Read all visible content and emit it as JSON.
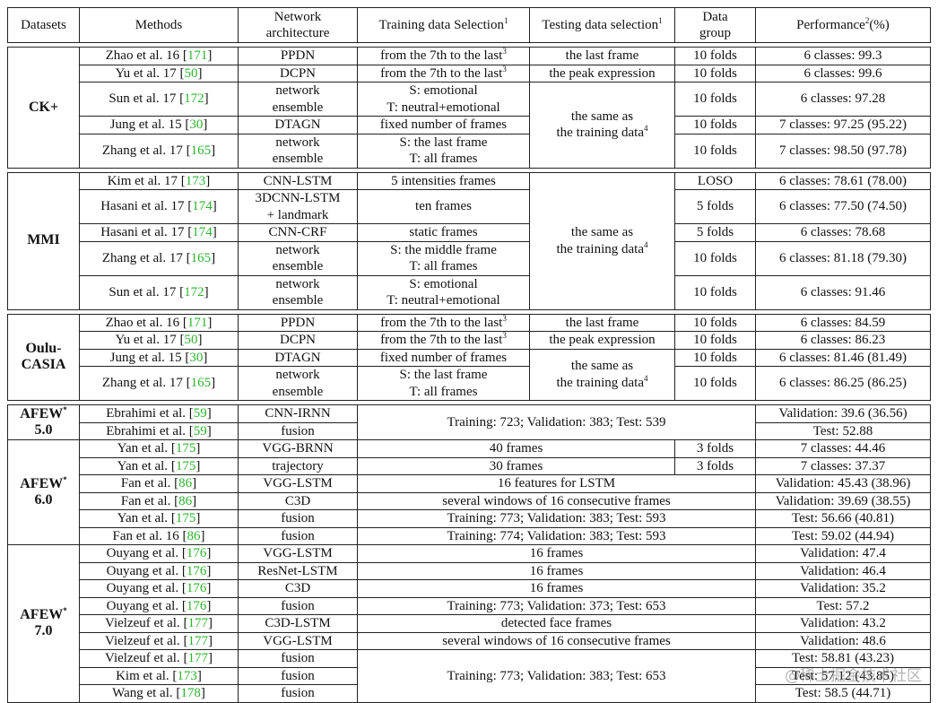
{
  "header": [
    {
      "t": "Datasets"
    },
    {
      "t": "Methods"
    },
    {
      "t": "Network\narchitecture"
    },
    {
      "t": "Training data Selection",
      "sup": "1"
    },
    {
      "t": "Testing data selection",
      "sup": "1"
    },
    {
      "t": "Data\ngroup"
    },
    {
      "t": "Performance",
      "sup": "2",
      "after": "(%)"
    }
  ],
  "accent_ref_color": "#2db32d",
  "watermark": "@稀土掘金技术社区",
  "blocks": [
    {
      "rows": [
        [
          {
            "t": "CK+",
            "ds": true,
            "rs": 5
          },
          {
            "m": "Zhao et al. 16",
            "ref": "171"
          },
          {
            "t": "PPDN"
          },
          {
            "t": "from the 7th to the last",
            "sup": "3"
          },
          {
            "t": "the last frame"
          },
          {
            "t": "10 folds"
          },
          {
            "t": "6 classes: 99.3"
          }
        ],
        [
          {
            "m": "Yu et al. 17",
            "ref": "50"
          },
          {
            "t": "DCPN"
          },
          {
            "t": "from the 7th to the last",
            "sup": "3"
          },
          {
            "t": "the peak expression"
          },
          {
            "t": "10 folds"
          },
          {
            "t": "6 classes: 99.6"
          }
        ],
        [
          {
            "m": "Sun et al. 17",
            "ref": "172"
          },
          {
            "t": "network\nensemble"
          },
          {
            "t": "S: emotional\nT: neutral+emotional"
          },
          {
            "t": "the same as\nthe training data",
            "sup": "4",
            "rs": 3
          },
          {
            "t": "10 folds"
          },
          {
            "t": "6 classes: 97.28"
          }
        ],
        [
          {
            "m": "Jung et al. 15",
            "ref": "30"
          },
          {
            "t": "DTAGN"
          },
          {
            "t": "fixed number of frames"
          },
          {
            "t": "10 folds"
          },
          {
            "t": "7 classes: 97.25 (95.22)"
          }
        ],
        [
          {
            "m": "Zhang et al. 17",
            "ref": "165"
          },
          {
            "t": "network\nensemble"
          },
          {
            "t": "S: the last frame\nT: all frames"
          },
          {
            "t": "10 folds"
          },
          {
            "t": "7 classes: 98.50 (97.78)"
          }
        ]
      ]
    },
    {
      "rows": [
        [
          {
            "t": "MMI",
            "ds": true,
            "rs": 5
          },
          {
            "m": "Kim et al. 17",
            "ref": "173"
          },
          {
            "t": "CNN-LSTM"
          },
          {
            "t": "5 intensities frames"
          },
          {
            "t": "the same as\nthe training data",
            "sup": "4",
            "rs": 5
          },
          {
            "t": "LOSO"
          },
          {
            "t": "6 classes: 78.61 (78.00)"
          }
        ],
        [
          {
            "m": "Hasani et al. 17",
            "ref": "174"
          },
          {
            "t": "3DCNN-LSTM\n+ landmark"
          },
          {
            "t": "ten frames"
          },
          {
            "t": "5 folds"
          },
          {
            "t": "6 classes: 77.50 (74.50)"
          }
        ],
        [
          {
            "m": "Hasani et al. 17",
            "ref": "174"
          },
          {
            "t": "CNN-CRF"
          },
          {
            "t": "static frames"
          },
          {
            "t": "5 folds"
          },
          {
            "t": "6 classes: 78.68"
          }
        ],
        [
          {
            "m": "Zhang et al. 17",
            "ref": "165"
          },
          {
            "t": "network\nensemble"
          },
          {
            "t": "S: the middle frame\nT: all frames"
          },
          {
            "t": "10 folds"
          },
          {
            "t": "6 classes: 81.18 (79.30)"
          }
        ],
        [
          {
            "m": "Sun et al. 17",
            "ref": "172"
          },
          {
            "t": "network\nensemble"
          },
          {
            "t": "S: emotional\nT: neutral+emotional"
          },
          {
            "t": "10 folds"
          },
          {
            "t": "6 classes: 91.46"
          }
        ]
      ]
    },
    {
      "rows": [
        [
          {
            "t": "Oulu-\nCASIA",
            "ds": true,
            "rs": 4
          },
          {
            "m": "Zhao et al. 16",
            "ref": "171"
          },
          {
            "t": "PPDN"
          },
          {
            "t": "from the 7th to the last",
            "sup": "3"
          },
          {
            "t": "the last frame"
          },
          {
            "t": "10 folds"
          },
          {
            "t": "6 classes: 84.59"
          }
        ],
        [
          {
            "m": "Yu et al. 17",
            "ref": "50"
          },
          {
            "t": "DCPN"
          },
          {
            "t": "from the 7th to the last",
            "sup": "3"
          },
          {
            "t": "the peak expression"
          },
          {
            "t": "10 folds"
          },
          {
            "t": "6 classes: 86.23"
          }
        ],
        [
          {
            "m": "Jung et al. 15",
            "ref": "30"
          },
          {
            "t": "DTAGN"
          },
          {
            "t": "fixed number of frames"
          },
          {
            "t": "the same as\nthe training data",
            "sup": "4",
            "rs": 2
          },
          {
            "t": "10 folds"
          },
          {
            "t": "6 classes: 81.46 (81.49)"
          }
        ],
        [
          {
            "m": "Zhang et al. 17",
            "ref": "165"
          },
          {
            "t": "network\nensemble"
          },
          {
            "t": "S: the last frame\nT: all frames"
          },
          {
            "t": "10 folds"
          },
          {
            "t": "6 classes: 86.25 (86.25)"
          }
        ]
      ]
    },
    {
      "rows": [
        [
          {
            "t": "AFEW",
            "sup": "*",
            "after": "\n5.0",
            "ds": true,
            "rs": 2
          },
          {
            "m": "Ebrahimi et al.",
            "ref": "59"
          },
          {
            "t": "CNN-IRNN"
          },
          {
            "t": "Training: 723; Validation: 383; Test: 539",
            "cs": 3,
            "rs": 2
          },
          {
            "t": "Validation: 39.6 (36.56)"
          }
        ],
        [
          {
            "m": "Ebrahimi et al.",
            "ref": "59"
          },
          {
            "t": "fusion"
          },
          {
            "t": "Test: 52.88"
          }
        ],
        [
          {
            "t": "AFEW",
            "sup": "*",
            "after": "\n6.0",
            "ds": true,
            "rs": 6
          },
          {
            "m": "Yan et al.",
            "ref": "175"
          },
          {
            "t": "VGG-BRNN"
          },
          {
            "t": "40 frames",
            "cs": 2
          },
          {
            "t": "3 folds"
          },
          {
            "t": "7 classes: 44.46"
          }
        ],
        [
          {
            "m": "Yan et al.",
            "ref": "175"
          },
          {
            "t": "trajectory"
          },
          {
            "t": "30 frames",
            "cs": 2
          },
          {
            "t": "3 folds"
          },
          {
            "t": "7 classes: 37.37"
          }
        ],
        [
          {
            "m": "Fan et al.",
            "ref": "86"
          },
          {
            "t": "VGG-LSTM"
          },
          {
            "t": "16 features for LSTM",
            "cs": 3
          },
          {
            "t": "Validation: 45.43 (38.96)"
          }
        ],
        [
          {
            "m": "Fan et al.",
            "ref": "86"
          },
          {
            "t": "C3D"
          },
          {
            "t": "several windows of 16 consecutive frames",
            "cs": 3
          },
          {
            "t": "Validation: 39.69 (38.55)"
          }
        ],
        [
          {
            "m": "Yan et al.",
            "ref": "175"
          },
          {
            "t": "fusion"
          },
          {
            "t": "Training: 773; Validation: 383; Test: 593",
            "cs": 3
          },
          {
            "t": "Test: 56.66 (40.81)"
          }
        ],
        [
          {
            "m": "Fan et al. 16",
            "ref": "86"
          },
          {
            "t": "fusion"
          },
          {
            "t": "Training: 774; Validation: 383; Test: 593",
            "cs": 3
          },
          {
            "t": "Test: 59.02 (44.94)"
          }
        ],
        [
          {
            "t": "AFEW",
            "sup": "*",
            "after": "\n7.0",
            "ds": true,
            "rs": 9
          },
          {
            "m": "Ouyang et al.",
            "ref": "176"
          },
          {
            "t": "VGG-LSTM"
          },
          {
            "t": "16 frames",
            "cs": 3
          },
          {
            "t": "Validation: 47.4"
          }
        ],
        [
          {
            "m": "Ouyang et al.",
            "ref": "176"
          },
          {
            "t": "ResNet-LSTM"
          },
          {
            "t": "16 frames",
            "cs": 3
          },
          {
            "t": "Validation: 46.4"
          }
        ],
        [
          {
            "m": "Ouyang et al.",
            "ref": "176"
          },
          {
            "t": "C3D"
          },
          {
            "t": "16 frames",
            "cs": 3
          },
          {
            "t": "Validation: 35.2"
          }
        ],
        [
          {
            "m": "Ouyang et al.",
            "ref": "176"
          },
          {
            "t": "fusion"
          },
          {
            "t": "Training: 773; Validation: 373; Test: 653",
            "cs": 3
          },
          {
            "t": "Test: 57.2"
          }
        ],
        [
          {
            "m": "Vielzeuf et al.",
            "ref": "177"
          },
          {
            "t": "C3D-LSTM"
          },
          {
            "t": "detected face frames",
            "cs": 3
          },
          {
            "t": "Validation: 43.2"
          }
        ],
        [
          {
            "m": "Vielzeuf et al.",
            "ref": "177"
          },
          {
            "t": "VGG-LSTM"
          },
          {
            "t": "several windows of 16 consecutive frames",
            "cs": 3
          },
          {
            "t": "Validation: 48.6"
          }
        ],
        [
          {
            "m": "Vielzeuf et al.",
            "ref": "177"
          },
          {
            "t": "fusion"
          },
          {
            "t": "Training: 773; Validation: 383; Test: 653",
            "cs": 3,
            "rs": 3
          },
          {
            "t": "Test: 58.81 (43.23)"
          }
        ],
        [
          {
            "m": "Kim et al.",
            "ref": "173"
          },
          {
            "t": "fusion"
          },
          {
            "t": "Test: 57.12 (43.85)"
          }
        ],
        [
          {
            "m": "Wang et al.",
            "ref": "178"
          },
          {
            "t": "fusion"
          },
          {
            "t": "Test: 58.5 (44.71)"
          }
        ]
      ]
    }
  ]
}
